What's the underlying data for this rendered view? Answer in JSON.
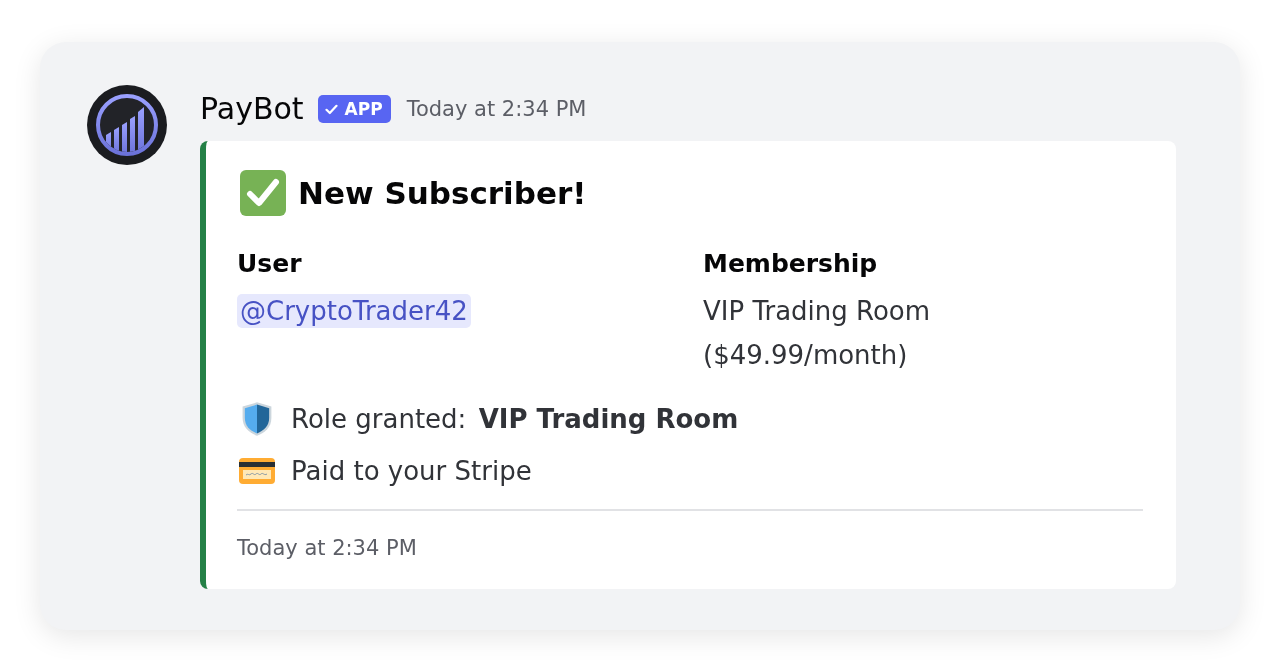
{
  "message": {
    "author": "PayBot",
    "badge": "APP",
    "timestamp": "Today at 2:34 PM",
    "embed": {
      "title": "New Subscriber!",
      "fields": [
        {
          "name": "User",
          "value": "@CryptoTrader42",
          "kind": "mention"
        },
        {
          "name": "Membership",
          "value": "VIP Trading Room ($49.99/month)",
          "kind": "text"
        }
      ],
      "lines": [
        {
          "kind": "role",
          "text": "Role granted: **VIP Trading Room**"
        },
        {
          "kind": "payment",
          "text": "Paid to your Stripe"
        }
      ],
      "footer": "Today at 2:34 PM"
    }
  }
}
